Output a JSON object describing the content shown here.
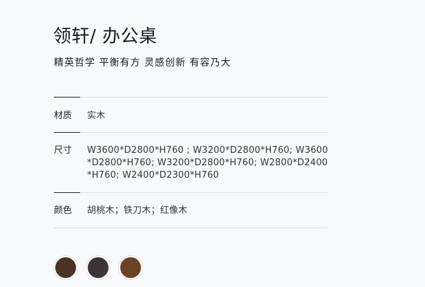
{
  "product": {
    "title": "领轩/ 办公桌",
    "tagline": "精英哲学 平衡有方 灵感创新 有容乃大"
  },
  "specs": [
    {
      "label": "材质",
      "value": "实木"
    },
    {
      "label": "尺寸",
      "value": "W3600*D2800*H760 ; W3200*D2800*H760; W3600*D2800*H760;  W3200*D2800*H760; W2800*D2400*H760; W2400*D2300*H760"
    },
    {
      "label": "颜色",
      "value": "胡桃木；铁刀木；红像木"
    }
  ],
  "swatches": [
    {
      "name": "胡桃木",
      "color": "#4a3322"
    },
    {
      "name": "铁刀木",
      "color": "#3d3236"
    },
    {
      "name": "红像木",
      "color": "#6b4222"
    }
  ]
}
